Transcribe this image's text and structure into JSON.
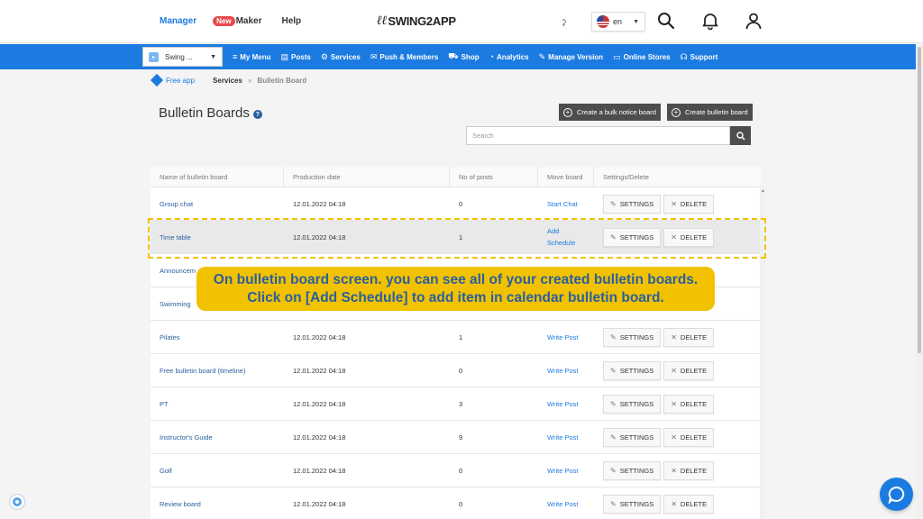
{
  "header": {
    "manager": "Manager",
    "new_badge": "New",
    "maker": "Maker",
    "help": "Help",
    "logo": "SWING2APP",
    "lang": "en"
  },
  "nav": {
    "app_select": "Swing ...",
    "items": [
      "My Menu",
      "Posts",
      "Services",
      "Push & Members",
      "Shop",
      "Analytics",
      "Manage Version",
      "Online Stores",
      "Support"
    ]
  },
  "breadcrumb": {
    "free_app": "Free app",
    "services": "Services",
    "separator": "»",
    "current": "Bulletin Board"
  },
  "page": {
    "title": "Bulletin Boards",
    "help": "?",
    "bulk_button": "Create a bulk notice board",
    "create_button": "Create bulletin board",
    "search_placeholder": "Search"
  },
  "table": {
    "headers": [
      "Name of bulletin board",
      "Production date",
      "No of posts",
      "Move board",
      "Settings/Delete"
    ],
    "settings_label": "SETTINGS",
    "delete_label": "DELETE",
    "rows": [
      {
        "name": "Group chat",
        "date": "12.01.2022 04:18",
        "posts": "0",
        "move": "Start Chat"
      },
      {
        "name": "Time table",
        "date": "12.01.2022 04:18",
        "posts": "1",
        "move": "Add Schedule"
      },
      {
        "name": "Announcem",
        "date": "",
        "posts": "",
        "move": ""
      },
      {
        "name": "Swimming",
        "date": "",
        "posts": "",
        "move": ""
      },
      {
        "name": "Pilates",
        "date": "12.01.2022 04:18",
        "posts": "1",
        "move": "Write Post"
      },
      {
        "name": "Free bulletin board (timeline)",
        "date": "12.01.2022 04:18",
        "posts": "0",
        "move": "Write Post"
      },
      {
        "name": "PT",
        "date": "12.01.2022 04:18",
        "posts": "3",
        "move": "Write Post"
      },
      {
        "name": "Instructor's Guide",
        "date": "12.01.2022 04:18",
        "posts": "9",
        "move": "Write Post"
      },
      {
        "name": "Golf",
        "date": "12.01.2022 04:18",
        "posts": "0",
        "move": "Write Post"
      },
      {
        "name": "Review board",
        "date": "12.01.2022 04:18",
        "posts": "0",
        "move": "Write Post"
      }
    ]
  },
  "callout": {
    "line1": "On bulletin board screen. you can see all of your created bulletin boards.",
    "line2": "Click on [Add Schedule] to add item in calendar bulletin board."
  },
  "colors": {
    "brand_blue": "#1b7be0",
    "highlight_yellow": "#f2c200",
    "dark_button": "#4d4d4d"
  }
}
